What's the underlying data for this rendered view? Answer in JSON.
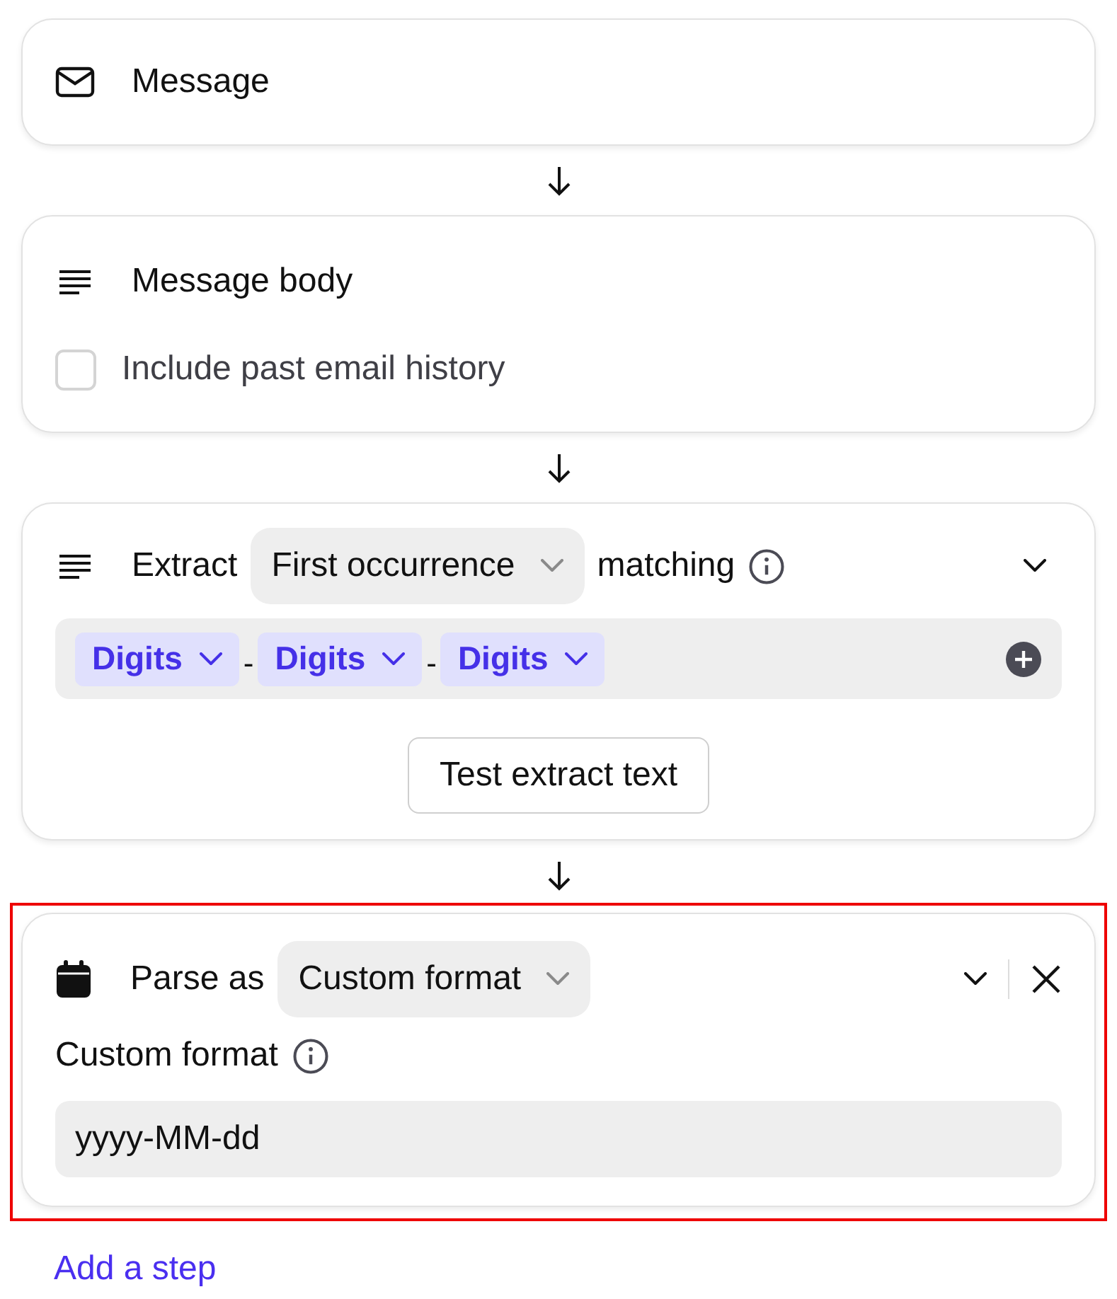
{
  "steps": [
    {
      "kind": "message",
      "title": "Message"
    },
    {
      "kind": "body",
      "title": "Message body",
      "checkbox": {
        "label": "Include past email history",
        "checked": false
      }
    },
    {
      "kind": "extract",
      "label": "Extract",
      "dropdown": "First occurrence",
      "suffix": "matching",
      "tokens": [
        "Digits",
        "Digits",
        "Digits"
      ],
      "separators": [
        "-",
        "-"
      ],
      "button": "Test extract text"
    },
    {
      "kind": "parse",
      "label": "Parse as",
      "dropdown": "Custom format",
      "field_label": "Custom format",
      "value": "yyyy-MM-dd",
      "highlighted": true
    }
  ],
  "add_step": "Add a step"
}
